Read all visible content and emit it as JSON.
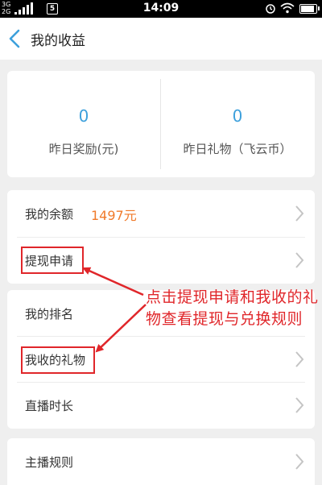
{
  "status_bar": {
    "network_top": "3G",
    "network_bottom": "2G",
    "sim_label": "5",
    "time": "14:09"
  },
  "header": {
    "title": "我的收益"
  },
  "stats": [
    {
      "value": "0",
      "label": "昨日奖励(元)"
    },
    {
      "value": "0",
      "label": "昨日礼物（飞云币）"
    }
  ],
  "list": {
    "balance_label": "我的余额",
    "balance_value": "1497元",
    "withdraw_label": "提现申请",
    "rank_label": "我的排名",
    "gifts_label": "我收的礼物",
    "live_duration_label": "直播时长",
    "rules_label": "主播规则"
  },
  "annotation": {
    "line1": "点击提现申请和我收的礼",
    "line2": "物查看提现与兑换规则"
  },
  "colors": {
    "accent_blue": "#3da0dc",
    "balance_orange": "#f07a2a",
    "annotation_red": "#e0262a"
  }
}
